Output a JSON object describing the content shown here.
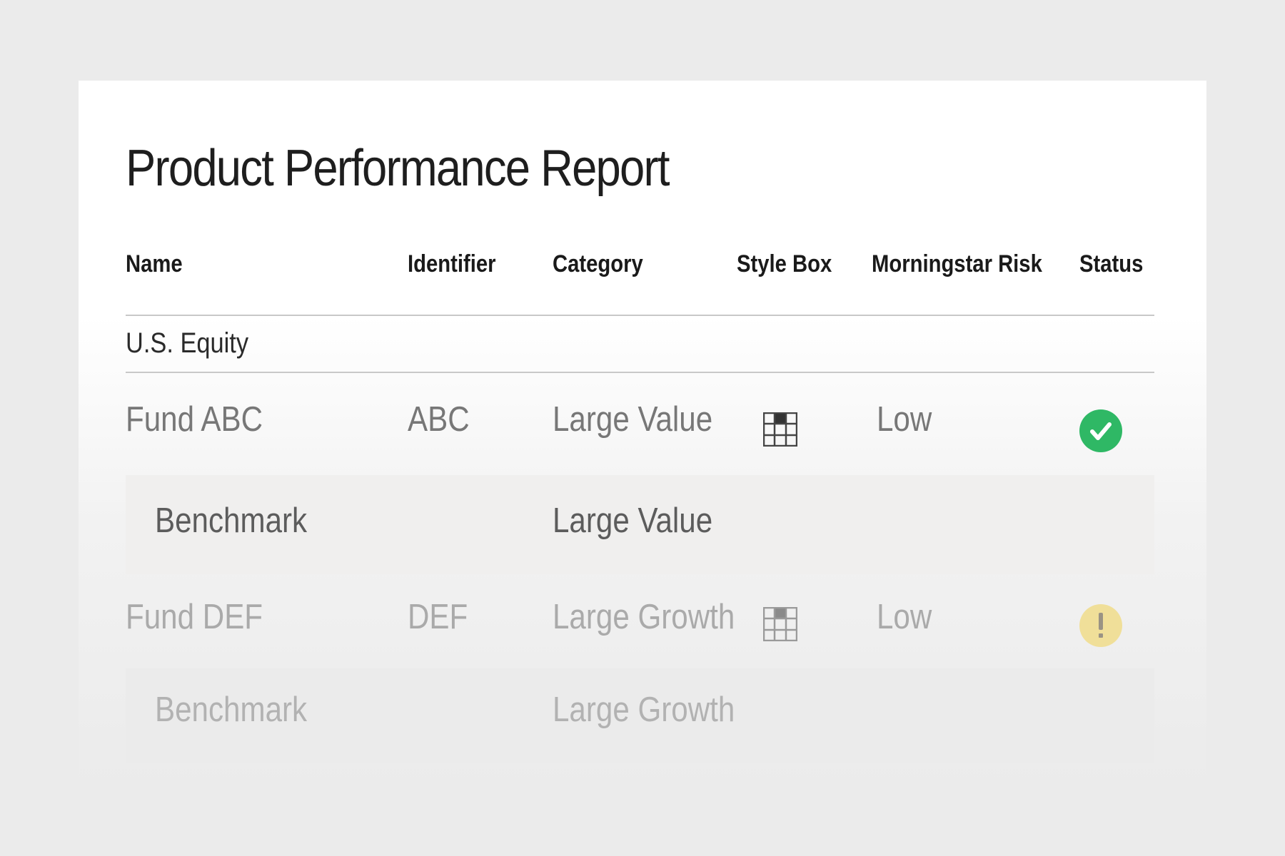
{
  "report": {
    "title": "Product Performance Report"
  },
  "table": {
    "columns": [
      "Name",
      "Identifier",
      "Category",
      "Style Box",
      "Morningstar Risk",
      "Status"
    ],
    "group_label": "U.S. Equity",
    "rows": [
      {
        "name": "Fund ABC",
        "identifier": "ABC",
        "category": "Large Value",
        "style_box_cell": "large-value",
        "risk": "Low",
        "status": "ok",
        "status_icon": "check-circle-icon"
      },
      {
        "name": "Benchmark",
        "identifier": "",
        "category": "Large Value"
      },
      {
        "name": "Fund DEF",
        "identifier": "DEF",
        "category": "Large Growth",
        "style_box_cell": "large-growth",
        "risk": "Low",
        "status": "warning",
        "status_icon": "exclamation-circle-icon"
      },
      {
        "name": "Benchmark",
        "identifier": "",
        "category": "Large Growth"
      }
    ]
  },
  "colors": {
    "status_ok": "#2fb865",
    "status_warning": "#f0df99",
    "background": "#ebebeb",
    "card": "#ffffff",
    "benchmark_row": "#f0efee"
  }
}
